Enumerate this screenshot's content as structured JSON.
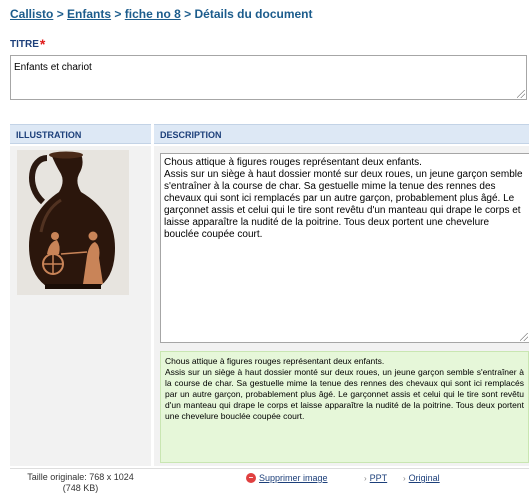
{
  "breadcrumb": {
    "items": [
      "Callisto",
      "Enfants",
      "fiche no 8"
    ],
    "current": "Détails du document",
    "separator": ">"
  },
  "title_field": {
    "label": "TITRE",
    "required_mark": "*",
    "value": "Enfants et chariot"
  },
  "table": {
    "col_illustration": "ILLUSTRATION",
    "col_description": "DESCRIPTION"
  },
  "description": {
    "value": "Chous attique à figures rouges représentant deux enfants.\nAssis sur un siège à haut dossier monté sur deux roues, un jeune garçon semble s'entraîner à la course de char. Sa gestuelle mime la tenue des rennes des chevaux qui sont ici remplacés par un autre garçon, probablement plus âgé. Le garçonnet assis et celui qui le tire sont revêtu d'un manteau qui drape le corps et laisse apparaître la nudité de la poitrine. Tous deux portent une chevelure bouclée coupée court.",
    "preview": "Chous attique à figures rouges représentant deux enfants.\nAssis sur un siège à haut dossier monté sur deux roues, un jeune garçon semble s'entraîner à la course de char. Sa gestuelle mime la tenue des rennes des chevaux qui sont ici remplacés par un autre garçon, probablement plus âgé. Le garçonnet assis et celui qui le tire sont revêtu d'un manteau qui drape le corps et laisse apparaître la nudité de la poitrine. Tous deux portent une chevelure bouclée coupée court."
  },
  "image_info": {
    "size_line1": "Taille originale: 768 x 1024",
    "size_line2": "(748 KB)"
  },
  "actions": {
    "delete_label": "Supprimer image",
    "ppt_label": "PPT",
    "original_label": "Original"
  },
  "colors": {
    "link": "#1c5c8c",
    "header_bg": "#dde8f5",
    "preview_bg": "#e6f7d9",
    "required": "#e01a1a"
  }
}
